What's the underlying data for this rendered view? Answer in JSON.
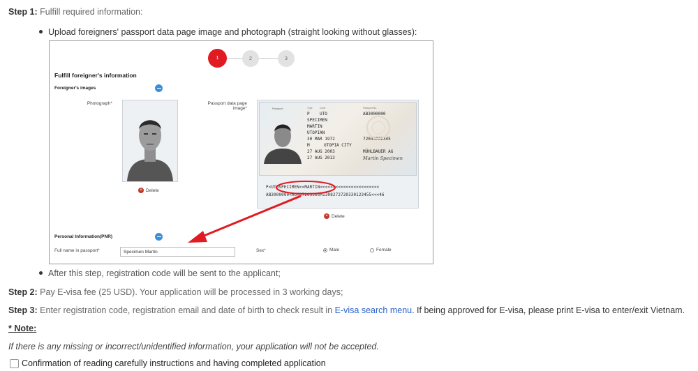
{
  "step1": {
    "label": "Step 1:",
    "text": "Fulfill required information:"
  },
  "bullet1": "Upload foreigners' passport data page image and photograph (straight looking without glasses):",
  "embedded": {
    "stepper": [
      "1",
      "2",
      "3"
    ],
    "fulfill_title": "Fulfill foreigner's information",
    "images_section": "Foreigner's images",
    "photograph_label": "Photograph",
    "passport_label_line1": "Passport data page",
    "passport_label_line2": "image",
    "delete_label": "Delete",
    "personal_section": "Personal Information(PNR)",
    "fullname_label": "Full name in passport",
    "fullname_value": "Specimen Martin",
    "sex_label": "Sex",
    "male_label": "Male",
    "female_label": "Female",
    "passport": {
      "type": "P",
      "country": "UTO",
      "number": "AB3000000",
      "surname": "SPECIMEN",
      "given": "MARTIN",
      "nationality": "UTOPIAN",
      "dob": "30 MAR 1972",
      "personal_no": "72033032345",
      "sex": "M",
      "pob": "UTOPIA CITY",
      "issue": "27 AUG 2003",
      "authority": "MÜHLBAUER AG",
      "expiry": "27 AUG 2013",
      "signature": "Martin Specimen",
      "mrz1": "P<UTOSPECIMEN<<MARTIN<<<<<<<<<<<<<<<<<<<<<<<",
      "mrz2": "AB3000000<0UTO7203305M1308272720330123455<<<46",
      "header_passport": "Passport",
      "header_type_labels": [
        "Type",
        "Code",
        "Passport No."
      ]
    }
  },
  "bullet2": "After this step, registration code will be sent to the applicant;",
  "step2": {
    "label": "Step 2:",
    "text": "Pay E-visa fee (25 USD). Your application will be processed in 3 working days;"
  },
  "step3": {
    "label": "Step 3:",
    "text_before": "Enter registration code, registration email and date of birth to check result in",
    "link": "E-visa search menu",
    "text_after": ". If being approved for E-visa, please print E-visa to enter/exit Vietnam."
  },
  "note_title": "* Note:",
  "note_text": "If there is any missing or incorrect/unidentified information, your application will not be accepted.",
  "checkbox_label": "Confirmation of reading carefully instructions and having completed application",
  "colors": {
    "active_step": "#e01b22",
    "annotation": "#e01b22",
    "link": "#2a62c9",
    "collapse_icon": "#3a8fdc"
  }
}
